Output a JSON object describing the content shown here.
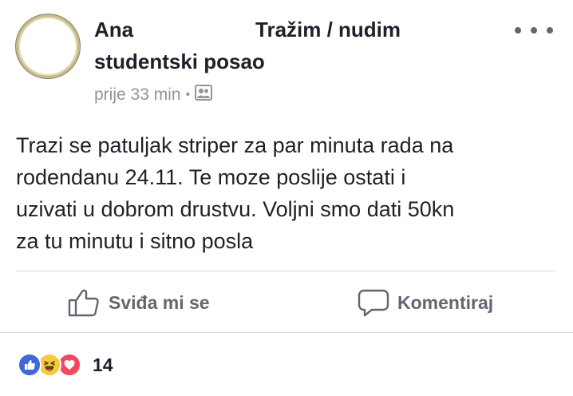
{
  "post": {
    "author": "Ana",
    "group_line1": "Tražim / nudim",
    "group_line2": "studentski posao",
    "time": "prije 33 min",
    "separator": "•",
    "privacy_icon": "group-members-icon",
    "text_lines": [
      "Trazi se patuljak striper za par minuta rada na",
      "rodendanu 24.11. Te moze poslije ostati i",
      "uzivati u dobrom drustvu. Voljni smo dati 50kn",
      "za tu minutu i sitno posla"
    ]
  },
  "actions": {
    "like_label": "Sviđa mi se",
    "comment_label": "Komentiraj"
  },
  "reactions": {
    "types": [
      "like",
      "haha",
      "love"
    ],
    "count": "14"
  },
  "colors": {
    "text": "#1d2129",
    "meta": "#90949c",
    "action": "#606770",
    "like": "#4267d8",
    "haha": "#f7c940",
    "love": "#f0485e"
  }
}
